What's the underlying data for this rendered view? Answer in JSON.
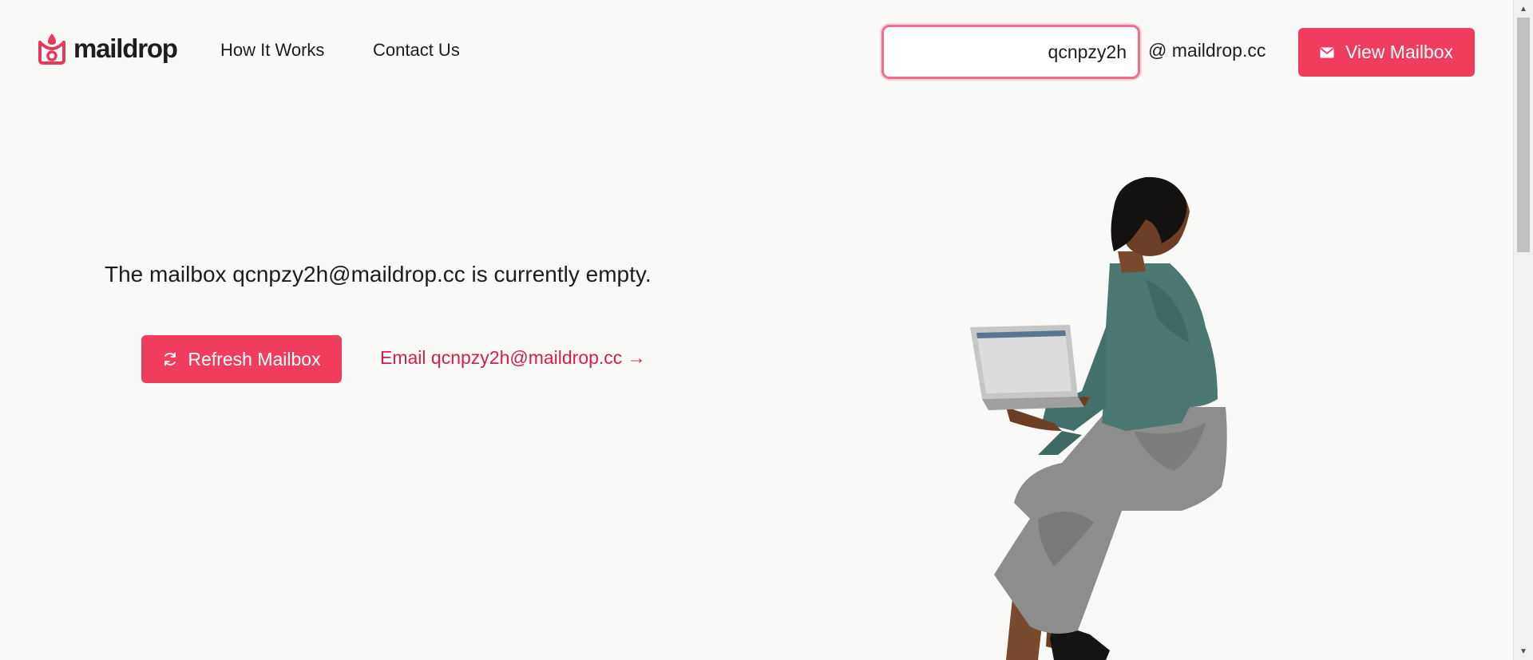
{
  "header": {
    "logo_text": "maildrop",
    "nav": {
      "how_it_works": "How It Works",
      "contact_us": "Contact Us"
    },
    "search": {
      "value": "qcnpzy2h",
      "domain_suffix": "@ maildrop.cc"
    },
    "view_mailbox_label": "View Mailbox"
  },
  "main": {
    "empty_message": "The mailbox qcnpzy2h@maildrop.cc is currently empty.",
    "refresh_label": "Refresh Mailbox",
    "email_link_label": "Email qcnpzy2h@maildrop.cc →"
  },
  "icons": {
    "logo": "maildrop-logo-icon",
    "envelope": "envelope-icon",
    "refresh": "refresh-icon",
    "illustration": "person-with-laptop-illustration"
  },
  "colors": {
    "accent": "#f03d5e",
    "link": "#d5204a",
    "background": "#f9f9f7",
    "input_border": "#ef6f8d"
  }
}
